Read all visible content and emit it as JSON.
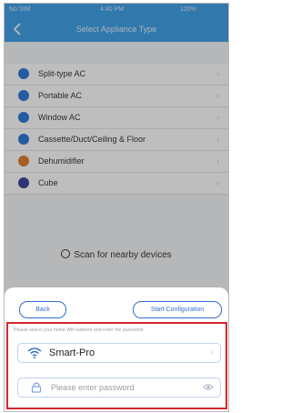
{
  "status_bar": {
    "carrier": "No SIM",
    "time": "4:40 PM",
    "battery": "100%"
  },
  "header": {
    "title": "Select Appliance Type"
  },
  "appliances": [
    {
      "label": "Split-type AC",
      "icon": "split-ac-icon",
      "color": "#2b77d6"
    },
    {
      "label": "Portable AC",
      "icon": "portable-ac-icon",
      "color": "#2b77d6"
    },
    {
      "label": "Window AC",
      "icon": "window-ac-icon",
      "color": "#2b77d6"
    },
    {
      "label": "Cassette/Duct/Ceiling & Floor",
      "icon": "cassette-ac-icon",
      "color": "#2b77d6"
    },
    {
      "label": "Dehumidifier",
      "icon": "dehumidifier-icon",
      "color": "#e07a2a"
    },
    {
      "label": "Cube",
      "icon": "cube-icon",
      "color": "#3a3f9a"
    }
  ],
  "scan": {
    "label": "Scan for nearby devices"
  },
  "sheet": {
    "back_label": "Back",
    "start_label": "Start Configuration",
    "hint": "Please select your home Wifi network and enter the password",
    "wifi_name": "Smart-Pro",
    "password_placeholder": "Please enter password"
  },
  "colors": {
    "accent": "#3c9ee8",
    "button": "#2f6fd0",
    "highlight": "#d5262e"
  }
}
